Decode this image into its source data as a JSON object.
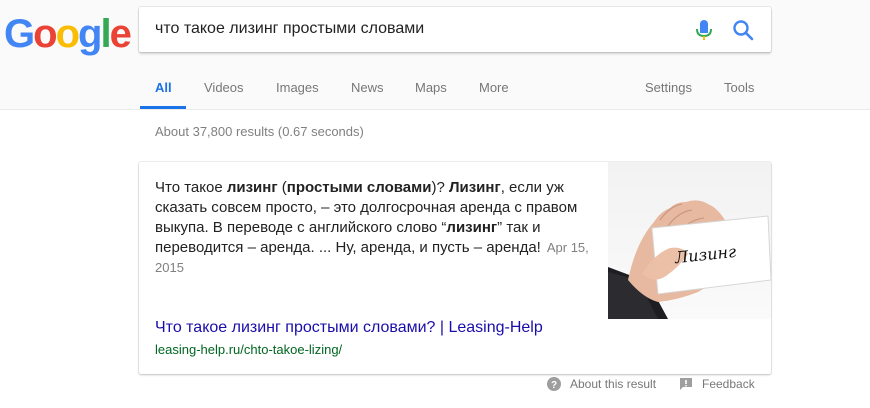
{
  "logo": {
    "text": "Google",
    "letters": [
      "G",
      "o",
      "o",
      "g",
      "l",
      "e"
    ],
    "colors": [
      "#4285F4",
      "#EA4335",
      "#FBBC05",
      "#4285F4",
      "#34A853",
      "#EA4335"
    ]
  },
  "search": {
    "query": "что такое лизинг простыми словами"
  },
  "tabs": {
    "all": "All",
    "videos": "Videos",
    "images": "Images",
    "news": "News",
    "maps": "Maps",
    "more": "More",
    "settings": "Settings",
    "tools": "Tools"
  },
  "stats": "About 37,800 results (0.67 seconds)",
  "snippet": {
    "segments": [
      {
        "text": "Что такое ",
        "bold": false
      },
      {
        "text": "лизинг",
        "bold": true
      },
      {
        "text": " (",
        "bold": false
      },
      {
        "text": "простыми словами",
        "bold": true
      },
      {
        "text": ")? ",
        "bold": false
      },
      {
        "text": "Лизинг",
        "bold": true
      },
      {
        "text": ", если уж сказать совсем просто, – это долгосрочная аренда с правом выкупа. В переводе с английского слово “",
        "bold": false
      },
      {
        "text": "лизинг",
        "bold": true
      },
      {
        "text": "” так и переводится – аренда. ... Ну, аренда, и пусть – аренда!",
        "bold": false
      }
    ],
    "date": "Apr 15, 2015",
    "image_caption": "Лизинг"
  },
  "result": {
    "title": "Что такое лизинг простыми словами? | Leasing-Help",
    "url": "leasing-help.ru/chto-takoe-lizing/"
  },
  "footer": {
    "about": "About this result",
    "feedback": "Feedback"
  },
  "colors": {
    "accent": "#1a73e8",
    "link": "#1a0dab",
    "url": "#006621"
  }
}
